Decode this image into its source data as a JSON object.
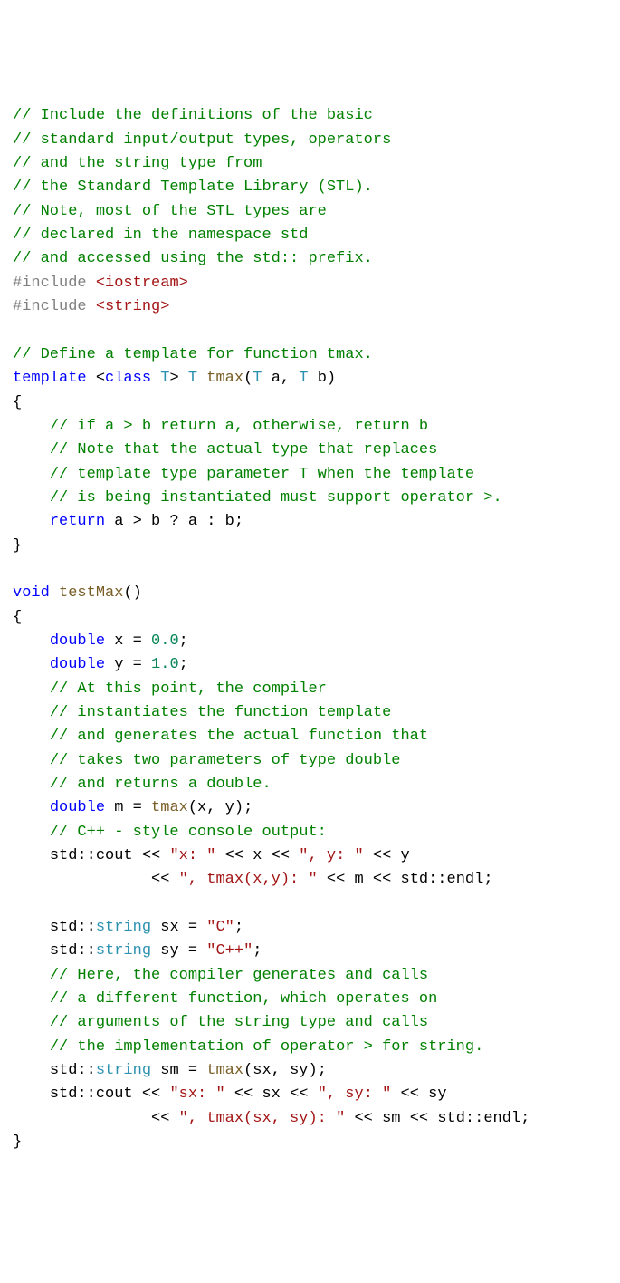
{
  "code": {
    "c1": "// Include the definitions of the basic",
    "c2": "// standard input/output types, operators",
    "c3": "// and the string type from",
    "c4": "// the Standard Template Library (STL).",
    "c5": "// Note, most of the STL types are",
    "c6": "// declared in the namespace std",
    "c7": "// and accessed using the std:: prefix.",
    "inc_kw": "#include",
    "inc1": " <iostream>",
    "inc2": " <string>",
    "c8": "// Define a template for function tmax.",
    "kw_template": "template",
    "lt": " <",
    "kw_class": "class",
    "sp": " ",
    "T": "T",
    "gt": "> ",
    "fn_tmax": "tmax",
    "lp": "(",
    "a": "a",
    "comma": ", ",
    "b": "b",
    "rp": ")",
    "lbrace": "{",
    "c9": "// if a > b return a, otherwise, return b",
    "c10": "// Note that the actual type that replaces",
    "c11": "// template type parameter T when the template",
    "c12": "// is being instantiated must support operator >.",
    "kw_return": "return",
    "expr_1": " a > b ? a : b;",
    "rbrace": "}",
    "kw_void": "void",
    "fn_testMax": "testMax",
    "emptyparen": "()",
    "kw_double": "double",
    "x": " x = ",
    "n0": "0.0",
    "semi": ";",
    "y": " y = ",
    "n1": "1.0",
    "c13": "// At this point, the compiler",
    "c14": "// instantiates the function template",
    "c15": "// and generates the actual function that",
    "c16": "// takes two parameters of type double",
    "c17": "// and returns a double.",
    "m": " m = ",
    "args_xy": "(x, y);",
    "c18": "// C++ - style console output:",
    "std": "std",
    "dcol": "::",
    "cout": "cout",
    "lsh": " << ",
    "s_x": "\"x: \"",
    "xx": "x",
    "s_y": "\", y: \"",
    "yy": "y",
    "s_tmax": "\", tmax(x,y): \"",
    "mm": "m",
    "endl": "endl",
    "string": "string",
    "sx_decl": " sx = ",
    "s_C": "\"C\"",
    "sy_decl": " sy = ",
    "s_Cpp": "\"C++\"",
    "c19": "// Here, the compiler generates and calls",
    "c20": "// a different function, which operates on",
    "c21": "// arguments of the string type and calls",
    "c22": "// the implementation of operator > for string.",
    "sm_decl": " sm = ",
    "args_sxy": "(sx, sy);",
    "s_sx": "\"sx: \"",
    "sx": "sx",
    "s_sy": "\", sy: \"",
    "sy": "sy",
    "s_tmax2": "\", tmax(sx, sy): \"",
    "sm": "sm"
  }
}
